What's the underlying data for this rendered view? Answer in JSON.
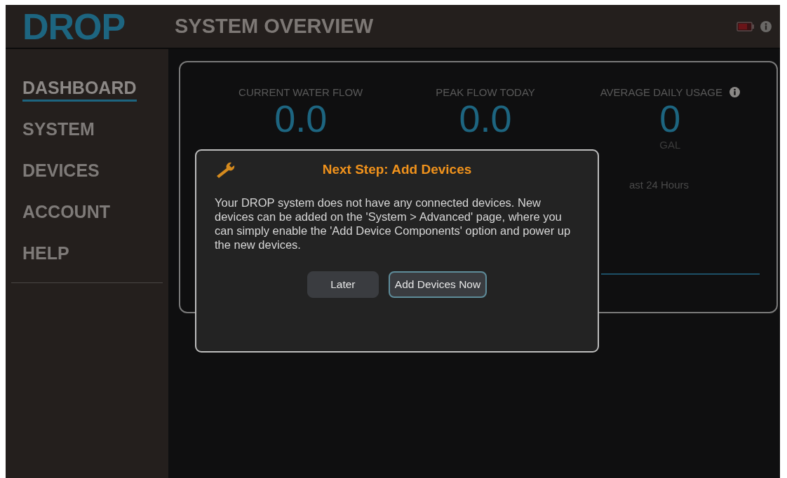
{
  "logo": "DROP",
  "header": {
    "title": "SYSTEM OVERVIEW"
  },
  "sidebar": {
    "items": [
      {
        "label": "DASHBOARD",
        "selected": true
      },
      {
        "label": "SYSTEM",
        "selected": false
      },
      {
        "label": "DEVICES",
        "selected": false
      },
      {
        "label": "ACCOUNT",
        "selected": false
      },
      {
        "label": "HELP",
        "selected": false
      }
    ]
  },
  "metrics": [
    {
      "label": "CURRENT WATER FLOW",
      "value": "0.0",
      "info": false
    },
    {
      "label": "PEAK FLOW TODAY",
      "value": "0.0",
      "info": false
    },
    {
      "label": "AVERAGE DAILY USAGE",
      "value": "0",
      "unit": "GAL",
      "info": true
    }
  ],
  "chart_caption": "ast 24 Hours",
  "dialog": {
    "title": "Next Step: Add Devices",
    "message": "Your DROP system does not have any connected devices.  New devices can be added on the 'System > Advanced' page, where you can simply enable the 'Add Device Components' option and power up the new devices.",
    "buttons": [
      {
        "label": "Later",
        "kind": "secondary"
      },
      {
        "label": "Add Devices Now",
        "kind": "primary"
      }
    ]
  }
}
